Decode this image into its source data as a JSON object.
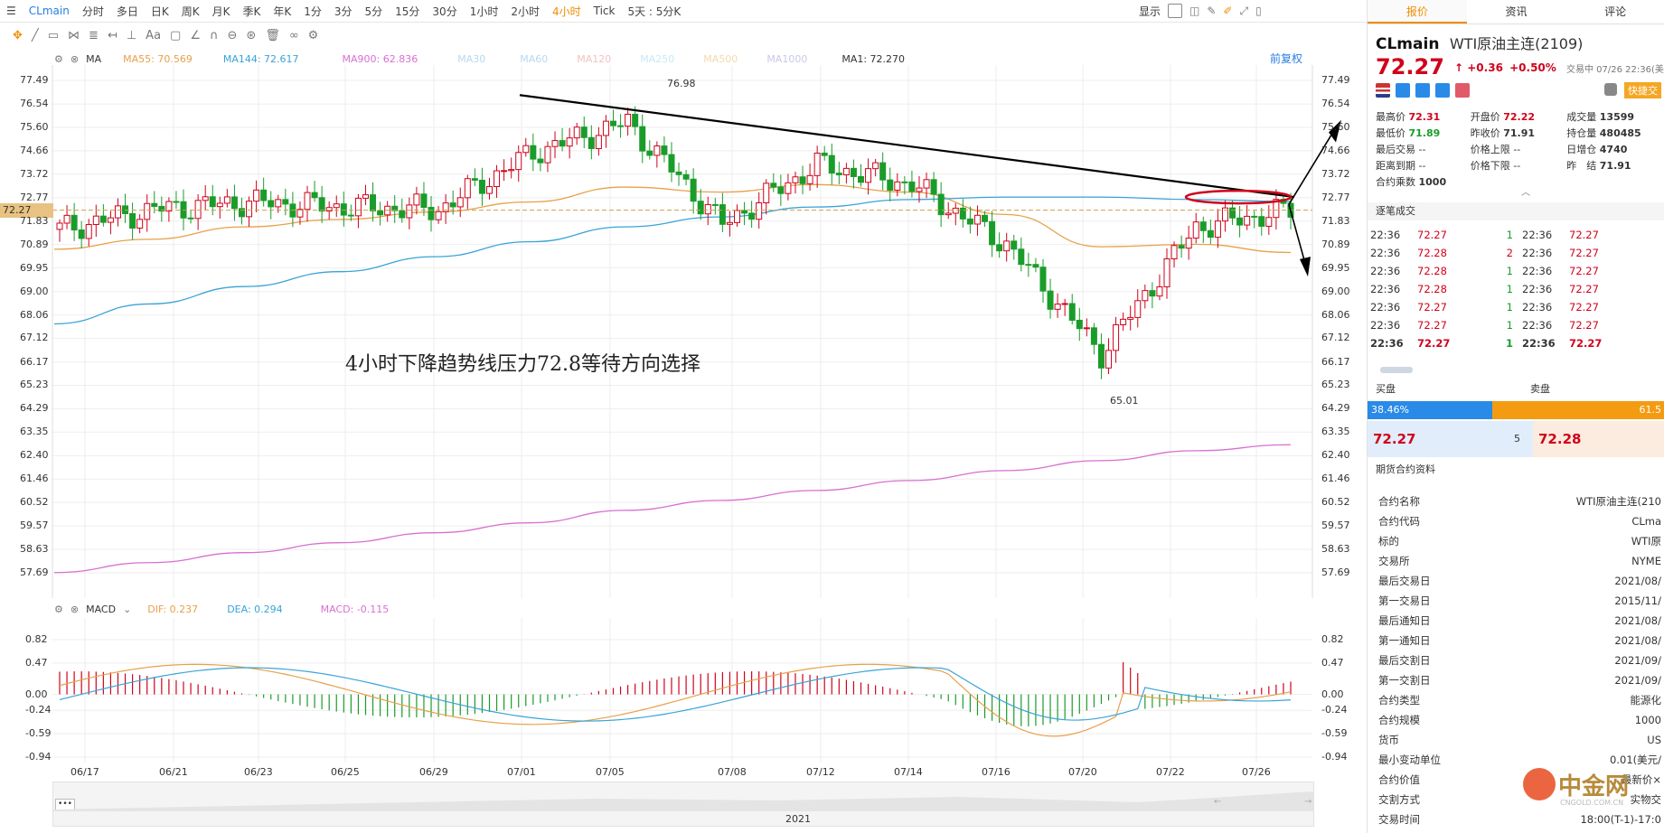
{
  "toolbar": {
    "symbol": "CLmain",
    "periods": [
      "分时",
      "多日",
      "日K",
      "周K",
      "月K",
      "季K",
      "年K",
      "1分",
      "3分",
      "5分",
      "15分",
      "30分",
      "1小时",
      "2小时",
      "4小时",
      "Tick",
      "5天 : 5分K"
    ],
    "active_period": "4小时",
    "display_label": "显示"
  },
  "legend": {
    "ma": "MA",
    "ma55": "MA55: 70.569",
    "ma144": "MA144: 72.617",
    "ma900": "MA900: 62.836",
    "ma30": "MA30",
    "ma60": "MA60",
    "ma120": "MA120",
    "ma250": "MA250",
    "ma500": "MA500",
    "ma1000": "MA1000",
    "ma1": "MA1: 72.270",
    "restore": "前复权"
  },
  "macd_legend": {
    "name": "MACD",
    "dif": "DIF: 0.237",
    "dea": "DEA: 0.294",
    "macd": "MACD: -0.115"
  },
  "price_axis": [
    "77.49",
    "76.54",
    "75.60",
    "74.66",
    "73.72",
    "72.77",
    "71.83",
    "70.89",
    "69.95",
    "69.00",
    "68.06",
    "67.12",
    "66.17",
    "65.23",
    "64.29",
    "63.35",
    "62.40",
    "61.46",
    "60.52",
    "59.57",
    "58.63",
    "57.69"
  ],
  "price_left_extra": "72.27",
  "macd_axis": [
    "0.82",
    "0.47",
    "0.00",
    "-0.24",
    "-0.59",
    "-0.94"
  ],
  "date_axis": [
    "06/17",
    "06/21",
    "06/23",
    "06/25",
    "06/29",
    "07/01",
    "07/05",
    "07/08",
    "07/12",
    "07/14",
    "07/16",
    "07/20",
    "07/22",
    "07/26"
  ],
  "high_label": "76.98",
  "low_label": "65.01",
  "annotation": "4小时下降趋势线压力72.8等待方向选择",
  "navigator_year": "2021",
  "navigator_dots": "•••",
  "panel": {
    "tabs": [
      "报价",
      "资讯",
      "评论"
    ],
    "code": "CLmain",
    "name": "WTI原油主连(2109)",
    "price": "72.27",
    "arrow": "↑",
    "change": "+0.36",
    "change_pct": "+0.50%",
    "status": "交易中 07/26 22:36(美",
    "quick_trade": "快捷交",
    "stats": [
      [
        "最高价 ",
        "72.31",
        "开盘价 ",
        "72.22",
        "成交量 ",
        "13599"
      ],
      [
        "最低价 ",
        "71.89",
        "昨收价 ",
        "71.91",
        "持仓量 ",
        "480485"
      ],
      [
        "最后交易 ",
        "--",
        "价格上限 ",
        "--",
        "日增仓 ",
        "4740"
      ],
      [
        "距离到期 ",
        "--",
        "价格下限 ",
        "--",
        "昨　结 ",
        "71.91"
      ],
      [
        "合约乘数 ",
        "1000",
        "",
        "",
        "",
        ""
      ]
    ],
    "trades_title": "逐笔成交",
    "trades": [
      [
        "22:36",
        "72.27",
        "1",
        "22:36",
        "72.27"
      ],
      [
        "22:36",
        "72.28",
        "2",
        "22:36",
        "72.27"
      ],
      [
        "22:36",
        "72.28",
        "1",
        "22:36",
        "72.27"
      ],
      [
        "22:36",
        "72.28",
        "1",
        "22:36",
        "72.27"
      ],
      [
        "22:36",
        "72.27",
        "1",
        "22:36",
        "72.27"
      ],
      [
        "22:36",
        "72.27",
        "1",
        "22:36",
        "72.27"
      ],
      [
        "22:36",
        "72.27",
        "1",
        "22:36",
        "72.27"
      ]
    ],
    "buy_label": "买盘",
    "sell_label": "卖盘",
    "buy_pct": "38.46%",
    "sell_pct": "61.5",
    "bid": "72.27",
    "bid_size": "5",
    "ask": "72.28",
    "info_title": "期货合约资料",
    "info": [
      [
        "合约名称",
        "WTI原油主连(210"
      ],
      [
        "合约代码",
        "CLma"
      ],
      [
        "标的",
        "WTI原"
      ],
      [
        "交易所",
        "NYME"
      ],
      [
        "最后交易日",
        "2021/08/"
      ],
      [
        "第一交易日",
        "2015/11/"
      ],
      [
        "最后通知日",
        "2021/08/"
      ],
      [
        "第一通知日",
        "2021/08/"
      ],
      [
        "最后交割日",
        "2021/09/"
      ],
      [
        "第一交割日",
        "2021/09/"
      ],
      [
        "合约类型",
        "能源化"
      ],
      [
        "合约规模",
        "1000"
      ],
      [
        "货币",
        "US"
      ],
      [
        "最小变动单位",
        "0.01(美元/"
      ],
      [
        "合约价值",
        "最新价×"
      ],
      [
        "交割方式",
        "实物交"
      ],
      [
        "交易时间",
        "18:00(T-1)-17:0"
      ]
    ],
    "watermark": "中金网",
    "watermark_sub": "CNGOLD.COM.CN"
  },
  "colors": {
    "up": "#d0021b",
    "down": "#1a9c2a",
    "ma55": "#e8a04a",
    "ma144": "#3aa3d8",
    "ma900": "#d86fd0",
    "accent": "#f08c00"
  },
  "chart_data": {
    "type": "line",
    "title": "",
    "ylim": [
      57.69,
      77.49
    ],
    "x": [
      "06/17",
      "06/21",
      "06/23",
      "06/25",
      "06/29",
      "07/01",
      "07/05",
      "07/08",
      "07/12",
      "07/14",
      "07/16",
      "07/20",
      "07/22",
      "07/26"
    ],
    "series": [
      {
        "name": "MA1: 72.270",
        "values": [
          71.5,
          72.3,
          72.6,
          72.4,
          72.3,
          74.6,
          75.8,
          71.7,
          74.1,
          73.3,
          70.9,
          66.5,
          71.6,
          72.27
        ]
      },
      {
        "name": "MA55: 70.569",
        "values": [
          70.7,
          71.1,
          71.6,
          71.9,
          72.2,
          72.6,
          73.2,
          73.0,
          73.3,
          73.0,
          72.1,
          70.8,
          70.9,
          70.57
        ]
      },
      {
        "name": "MA144: 72.617",
        "values": [
          67.7,
          68.5,
          69.2,
          69.8,
          70.4,
          71.0,
          71.6,
          72.0,
          72.4,
          72.7,
          72.8,
          72.8,
          72.7,
          72.62
        ]
      },
      {
        "name": "MA900: 62.836",
        "values": [
          57.7,
          58.1,
          58.5,
          58.9,
          59.3,
          59.7,
          60.2,
          60.6,
          61.0,
          61.4,
          61.8,
          62.2,
          62.6,
          62.84
        ]
      }
    ],
    "high": 76.98,
    "low": 65.01,
    "trendline_resistance": 72.8,
    "current": 72.27
  }
}
